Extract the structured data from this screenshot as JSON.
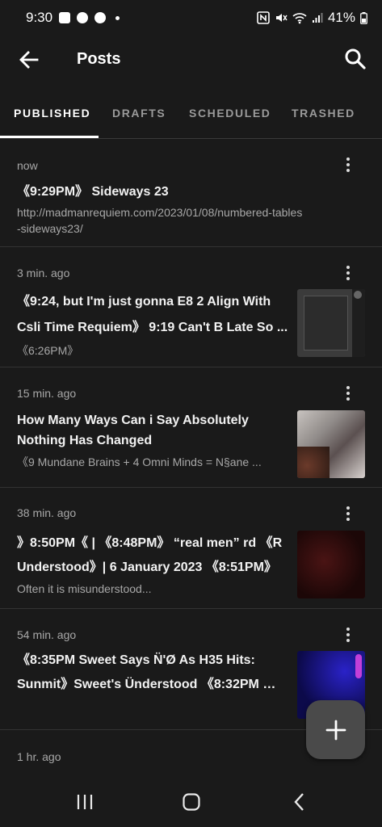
{
  "status_bar": {
    "time": "9:30",
    "battery": "41%"
  },
  "app_bar": {
    "title": "Posts"
  },
  "tabs": [
    {
      "label": "PUBLISHED"
    },
    {
      "label": "DRAFTS"
    },
    {
      "label": "SCHEDULED"
    },
    {
      "label": "TRASHED"
    }
  ],
  "posts": [
    {
      "time": "now",
      "title": "《9:29PM》 Sideways 23",
      "excerpt_line1": "http://madmanrequiem.com/2023/01/08/numbered-tables",
      "excerpt_line2": "-sideways23/"
    },
    {
      "time": "3 min. ago",
      "title_line1": "《9:24, but I'm just gonna E8 2 Align With",
      "title_line2": "Csli Time Requiem》 9:19 Can't B Late So ...",
      "excerpt": "《6:26PM》"
    },
    {
      "time": "15 min. ago",
      "title_line1": "How Many Ways Can i Say Absolutely",
      "title_line2": "Nothing Has Changed",
      "excerpt": "《9 Mundane Brains + 4 Omni Minds = N§ane ..."
    },
    {
      "time": "38 min. ago",
      "title_line1": "》8:50PM《 | 《8:48PM》 “real men” rd 《R",
      "title_line2": "Understood》| 6 January 2023 《8:51PM》",
      "excerpt": "Often it is misunderstood..."
    },
    {
      "time": "54 min. ago",
      "title_line1": "《8:35PM Sweet Says N̈'Ø As H35 Hits:",
      "title_line2": "Sunmit》Sweet's Ünderstood 《8:32PM M..."
    },
    {
      "time": "1 hr. ago"
    }
  ],
  "colors": {
    "background": "#1a1a1a",
    "fab": "#4a4a4a",
    "muted_text": "#a8a8a8"
  }
}
